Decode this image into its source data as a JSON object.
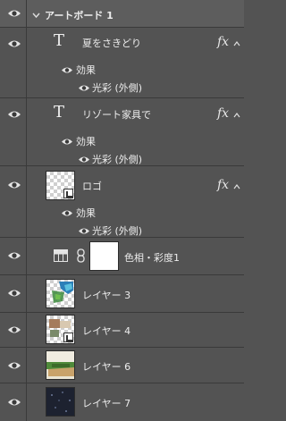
{
  "group": {
    "name": "アートボード 1",
    "expanded": true
  },
  "layers": [
    {
      "name": "夏をさきどり",
      "kind": "text",
      "effects_label": "効果",
      "effect": "光彩 (外側)",
      "fx": "fx"
    },
    {
      "name": "リゾート家具で",
      "kind": "text",
      "effects_label": "効果",
      "effect": "光彩 (外側)",
      "fx": "fx"
    },
    {
      "name": "ロゴ",
      "kind": "smart",
      "effects_label": "効果",
      "effect": "光彩 (外側)",
      "fx": "fx"
    },
    {
      "name": "色相・彩度1",
      "kind": "adjustment"
    },
    {
      "name": "レイヤー 3",
      "kind": "image"
    },
    {
      "name": "レイヤー 4",
      "kind": "smart"
    },
    {
      "name": "レイヤー 6",
      "kind": "image"
    },
    {
      "name": "レイヤー 7",
      "kind": "image"
    }
  ],
  "colors": {
    "panel": "#535353",
    "divider": "#3a3a3a",
    "text": "#ececec"
  },
  "icons": [
    "eye-icon",
    "disclosure-triangle-icon",
    "text-layer-icon",
    "fx-icon",
    "chevron-up-icon",
    "link-icon",
    "hue-saturation-icon",
    "smart-object-badge-icon"
  ]
}
